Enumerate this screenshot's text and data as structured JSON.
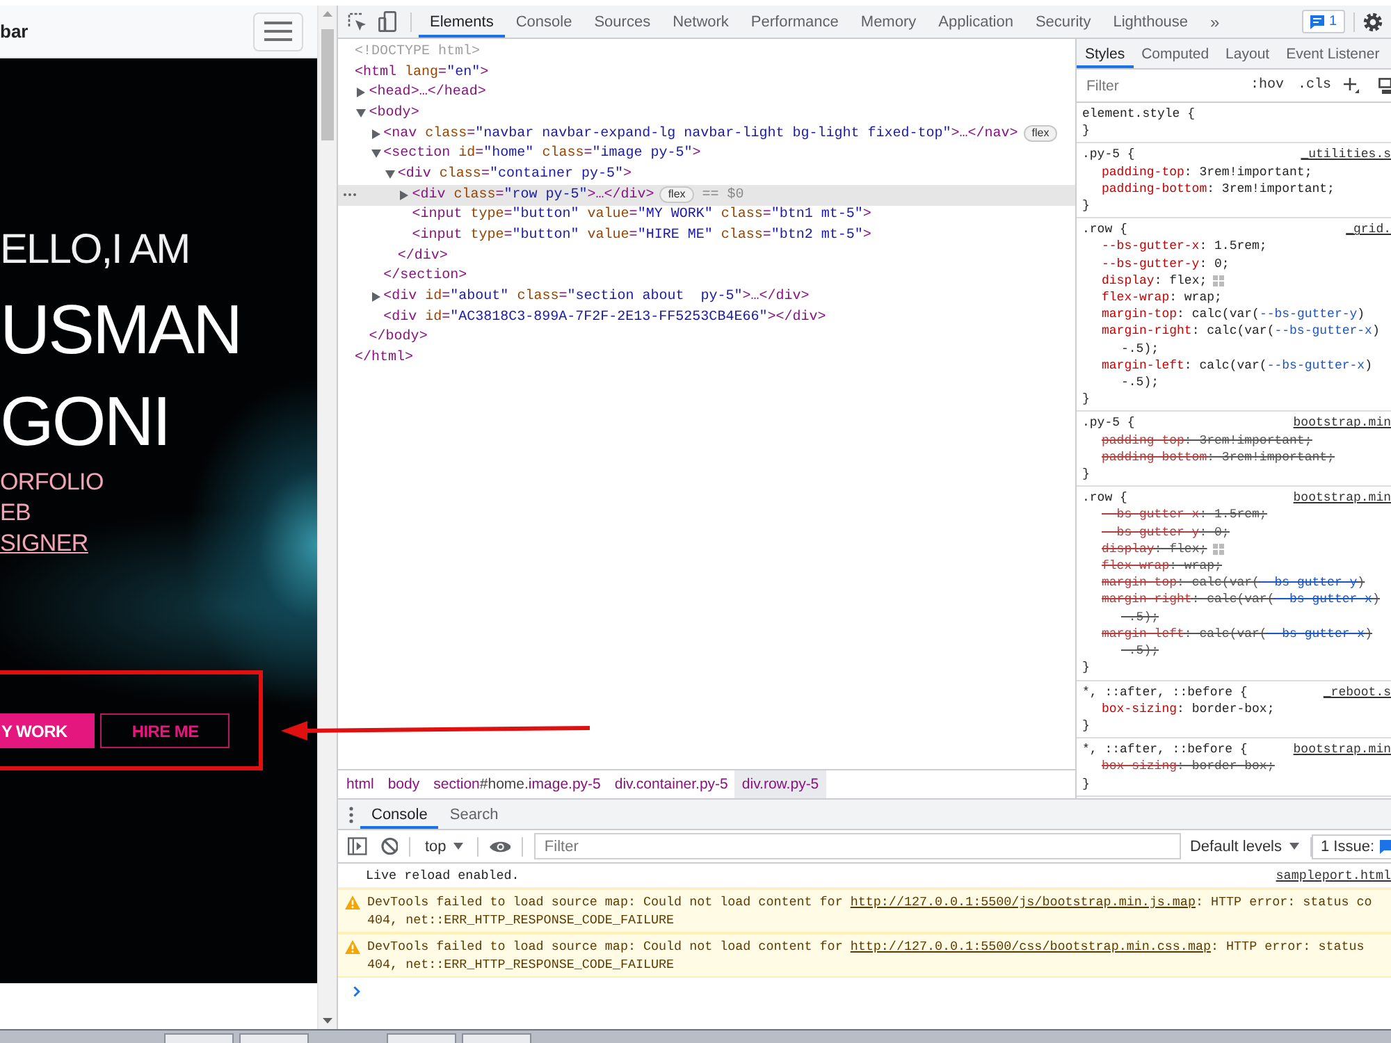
{
  "browser_page": {
    "navbar": {
      "brand": "bar"
    },
    "hero": {
      "greeting": "ELLO,I AM",
      "name_lines": [
        "USMAN",
        "GONI"
      ],
      "roles": [
        {
          "text": "ORFOLIO",
          "underlined": false
        },
        {
          "text": "EB",
          "underlined": false
        },
        {
          "text": "SIGNER",
          "underlined": true
        }
      ],
      "buttons": [
        {
          "label": "Y WORK",
          "kind": "filled"
        },
        {
          "label": "HIRE ME",
          "kind": "outline"
        }
      ]
    }
  },
  "devtools": {
    "tabs": [
      {
        "label": "Elements",
        "selected": true
      },
      {
        "label": "Console",
        "selected": false
      },
      {
        "label": "Sources",
        "selected": false
      },
      {
        "label": "Network",
        "selected": false
      },
      {
        "label": "Performance",
        "selected": false
      },
      {
        "label": "Memory",
        "selected": false
      },
      {
        "label": "Application",
        "selected": false
      },
      {
        "label": "Security",
        "selected": false
      },
      {
        "label": "Lighthouse",
        "selected": false
      }
    ],
    "more_tabs": "»",
    "issues_count": "1",
    "dom_tree": [
      {
        "kind": "doctype",
        "text": "<!DOCTYPE html>",
        "selected": false
      },
      {
        "kind": "plain",
        "text": "<html lang=\"en\">",
        "close": "</html>",
        "selected": false,
        "children": [
          {
            "kind": "toggle",
            "text": "<head>…</head>",
            "expanded": false,
            "selected": false
          },
          {
            "kind": "toggle",
            "text": "<body>",
            "expanded": true,
            "close": "</body>",
            "selected": false,
            "children": [
              {
                "kind": "toggle",
                "text": "<nav class=\"navbar navbar-expand-lg navbar-light bg-light fixed-top\">…</nav>",
                "expanded": false,
                "selected": false,
                "badge": "flex"
              },
              {
                "kind": "toggle",
                "text": "<section id=\"home\" class=\"image py-5\">",
                "expanded": true,
                "close": "</section>",
                "selected": false,
                "children": [
                  {
                    "kind": "toggle",
                    "text": "<div class=\"container py-5\">",
                    "expanded": true,
                    "close": "</div>",
                    "selected": false,
                    "children": [
                      {
                        "kind": "toggle",
                        "text": "<div class=\"row py-5\">…</div>",
                        "expanded": false,
                        "selected": true,
                        "badge": "flex",
                        "ref": "== $0"
                      },
                      {
                        "kind": "plain",
                        "text": "<input type=\"button\" value=\"MY WORK\" class=\"btn1 mt-5\">",
                        "selected": false
                      },
                      {
                        "kind": "plain",
                        "text": "<input type=\"button\" value=\"HIRE ME\" class=\"btn2 mt-5\">",
                        "selected": false
                      }
                    ]
                  }
                ]
              },
              {
                "kind": "toggle",
                "text": "<div id=\"about\" class=\"section about  py-5\">…</div>",
                "expanded": false,
                "selected": false
              },
              {
                "kind": "plain",
                "text": "<div id=\"AC3818C3-899A-7F2F-2E13-FF5253CB4E66\"></div>",
                "selected": false
              }
            ]
          }
        ]
      }
    ],
    "breadcrumbs": [
      {
        "label": "html",
        "selected": false
      },
      {
        "label": "body",
        "selected": false
      },
      {
        "label": "section#home.image.py-5",
        "selected": false
      },
      {
        "label": "div.container.py-5",
        "selected": false
      },
      {
        "label": "div.row.py-5",
        "selected": true
      }
    ],
    "styles": {
      "tabs": [
        {
          "label": "Styles",
          "selected": true
        },
        {
          "label": "Computed",
          "selected": false
        },
        {
          "label": "Layout",
          "selected": false
        },
        {
          "label": "Event Listener",
          "selected": false
        }
      ],
      "filter": {
        "placeholder": "Filter"
      },
      "toggles": [
        ":hov",
        ".cls"
      ],
      "rules": [
        {
          "selector": "element.style {",
          "close": "}"
        },
        {
          "selector": ".py-5 {",
          "source": "_utilities.s",
          "close": "}",
          "declarations": [
            {
              "text": "padding-top: 3rem!important;",
              "overridden": false
            },
            {
              "text": "padding-bottom: 3rem!important;",
              "overridden": false
            }
          ]
        },
        {
          "selector": ".row {",
          "source": "_grid.",
          "close": "}",
          "declarations": [
            {
              "text": "--bs-gutter-x: 1.5rem;",
              "overridden": false
            },
            {
              "text": "--bs-gutter-y: 0;",
              "overridden": false
            },
            {
              "text": "display: flex;",
              "overridden": false,
              "editor_icon": true
            },
            {
              "text": "flex-wrap: wrap;",
              "overridden": false
            },
            {
              "text": "margin-top: calc(var(--bs-gutter-y)",
              "overridden": false
            },
            {
              "text": "margin-right: calc(var(--bs-gutter-x)",
              "continuation": "-.5);",
              "overridden": false
            },
            {
              "text": "margin-left: calc(var(--bs-gutter-x)",
              "continuation": "-.5);",
              "overridden": false
            }
          ]
        },
        {
          "selector": ".py-5 {",
          "source": "bootstrap.min",
          "close": "}",
          "declarations": [
            {
              "text": "padding-top: 3rem!important;",
              "overridden": true
            },
            {
              "text": "padding-bottom: 3rem!important;",
              "overridden": true
            }
          ]
        },
        {
          "selector": ".row {",
          "source": "bootstrap.min",
          "close": "}",
          "declarations": [
            {
              "text": "--bs-gutter-x: 1.5rem;",
              "overridden": true
            },
            {
              "text": "--bs-gutter-y: 0;",
              "overridden": true
            },
            {
              "text": "display: flex;",
              "overridden": true,
              "editor_icon": true
            },
            {
              "text": "flex-wrap: wrap;",
              "overridden": true
            },
            {
              "text": "margin-top: calc(var(--bs-gutter-y)",
              "overridden": true
            },
            {
              "text": "margin-right: calc(var(--bs-gutter-x)",
              "continuation": "-.5);",
              "overridden": true
            },
            {
              "text": "margin-left: calc(var(--bs-gutter-x)",
              "continuation": "-.5);",
              "overridden": true
            }
          ]
        },
        {
          "selector": "*, ::after, ::before {",
          "source": "_reboot.s",
          "close": "}",
          "declarations": [
            {
              "text": "box-sizing: border-box;",
              "overridden": false
            }
          ]
        },
        {
          "selector": "*, ::after, ::before {",
          "source": "bootstrap.min",
          "close": "}",
          "declarations": [
            {
              "text": "box-sizing: border-box;",
              "overridden": true
            }
          ]
        }
      ]
    },
    "console": {
      "tabs": [
        {
          "label": "Console",
          "selected": true
        },
        {
          "label": "Search",
          "selected": false
        }
      ],
      "context": "top",
      "filter": {
        "placeholder": "Filter"
      },
      "levels": "Default levels",
      "issues": "1 Issue:",
      "messages": [
        {
          "kind": "info",
          "text": "Live reload enabled.",
          "source": "sampleport.html"
        },
        {
          "kind": "warning",
          "text": "DevTools failed to load source map: Could not load content for ",
          "link": "http://127.0.0.1:5500/js/bootstrap.min.js.map",
          "after": ": HTTP error: status co",
          "second_line": "404, net::ERR_HTTP_RESPONSE_CODE_FAILURE"
        },
        {
          "kind": "warning",
          "text": "DevTools failed to load source map: Could not load content for ",
          "link": "http://127.0.0.1:5500/css/bootstrap.min.css.map",
          "after": ": HTTP error: status",
          "second_line": "404, net::ERR_HTTP_RESPONSE_CODE_FAILURE"
        }
      ]
    }
  }
}
